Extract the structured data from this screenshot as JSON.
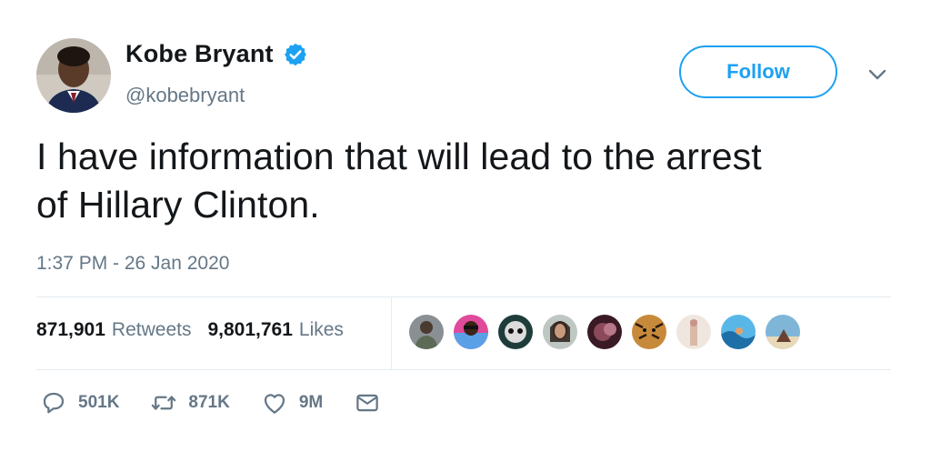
{
  "author": {
    "name": "Kobe Bryant",
    "handle": "@kobebryant",
    "verified": true
  },
  "follow_button": {
    "label": "Follow"
  },
  "tweet": {
    "text_line1": "I have information that will lead to the arrest",
    "text_line2": "of Hillary Clinton.",
    "timestamp": "1:37 PM - 26 Jan 2020"
  },
  "stats": {
    "retweets_count": "871,901",
    "retweets_label": "Retweets",
    "likes_count": "9,801,761",
    "likes_label": "Likes"
  },
  "actions": {
    "reply_count": "501K",
    "retweet_count": "871K",
    "like_count": "9M"
  },
  "colors": {
    "accent": "#1da1f2",
    "text": "#14171a",
    "muted": "#657786",
    "divider": "#e6ecf0"
  },
  "icons": [
    "verified-badge-icon",
    "chevron-down-icon",
    "reply-icon",
    "retweet-icon",
    "heart-icon",
    "envelope-icon"
  ]
}
